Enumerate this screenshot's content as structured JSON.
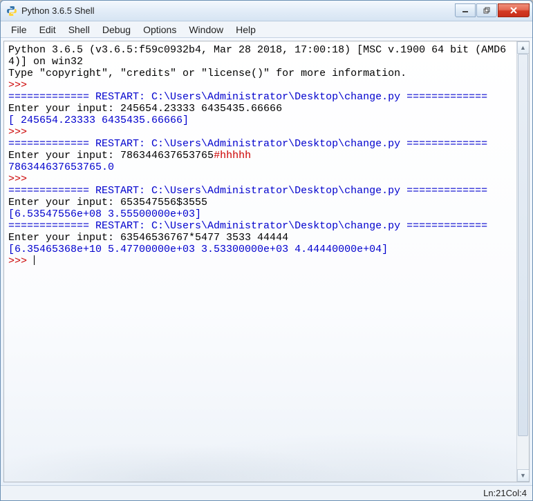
{
  "title": "Python 3.6.5 Shell",
  "menu": {
    "file": "File",
    "edit": "Edit",
    "shell": "Shell",
    "debug": "Debug",
    "options": "Options",
    "window": "Window",
    "help": "Help"
  },
  "console_lines": [
    {
      "segs": [
        {
          "cls": "black",
          "text": "Python 3.6.5 (v3.6.5:f59c0932b4, Mar 28 2018, 17:00:18) [MSC v.1900 64 bit (AMD6"
        }
      ]
    },
    {
      "segs": [
        {
          "cls": "black",
          "text": "4)] on win32"
        }
      ]
    },
    {
      "segs": [
        {
          "cls": "black",
          "text": "Type \"copyright\", \"credits\" or \"license()\" for more information."
        }
      ]
    },
    {
      "segs": [
        {
          "cls": "red",
          "text": ">>> "
        }
      ]
    },
    {
      "segs": [
        {
          "cls": "blue",
          "text": "============= RESTART: C:\\Users\\Administrator\\Desktop\\change.py ============="
        }
      ]
    },
    {
      "segs": [
        {
          "cls": "black",
          "text": "Enter your input: 245654.23333 6435435.66666"
        }
      ]
    },
    {
      "segs": [
        {
          "cls": "blue",
          "text": "[ 245654.23333 6435435.66666]"
        }
      ]
    },
    {
      "segs": [
        {
          "cls": "red",
          "text": ">>> "
        }
      ]
    },
    {
      "segs": [
        {
          "cls": "blue",
          "text": "============= RESTART: C:\\Users\\Administrator\\Desktop\\change.py ============="
        }
      ]
    },
    {
      "segs": [
        {
          "cls": "black",
          "text": "Enter your input: 786344637653765"
        },
        {
          "cls": "red",
          "text": "#hhhhh"
        }
      ]
    },
    {
      "segs": [
        {
          "cls": "blue",
          "text": "786344637653765.0"
        }
      ]
    },
    {
      "segs": [
        {
          "cls": "red",
          "text": ">>> "
        }
      ]
    },
    {
      "segs": [
        {
          "cls": "blue",
          "text": "============= RESTART: C:\\Users\\Administrator\\Desktop\\change.py ============="
        }
      ]
    },
    {
      "segs": [
        {
          "cls": "black",
          "text": "Enter your input: 653547556$3555"
        }
      ]
    },
    {
      "segs": [
        {
          "cls": "blue",
          "text": "[6.53547556e+08 3.55500000e+03]"
        }
      ]
    },
    {
      "segs": [
        {
          "cls": "blue",
          "text": "============= RESTART: C:\\Users\\Administrator\\Desktop\\change.py ============="
        }
      ]
    },
    {
      "segs": [
        {
          "cls": "black",
          "text": "Enter your input: 63546536767*5477 3533 44444"
        }
      ]
    },
    {
      "segs": [
        {
          "cls": "blue",
          "text": "[6.35465368e+10 5.47700000e+03 3.53300000e+03 4.44440000e+04]"
        }
      ]
    },
    {
      "segs": [
        {
          "cls": "red",
          "text": ">>> "
        }
      ],
      "cursor": true
    }
  ],
  "status": {
    "line_label": "Ln: ",
    "line_value": "21",
    "col_label": "  Col: ",
    "col_value": "4"
  },
  "icons": {
    "app": "python-icon",
    "minimize": "minimize-icon",
    "maximize": "maximize-icon",
    "close": "close-icon",
    "scroll_up": "scroll-up-icon",
    "scroll_down": "scroll-down-icon"
  }
}
